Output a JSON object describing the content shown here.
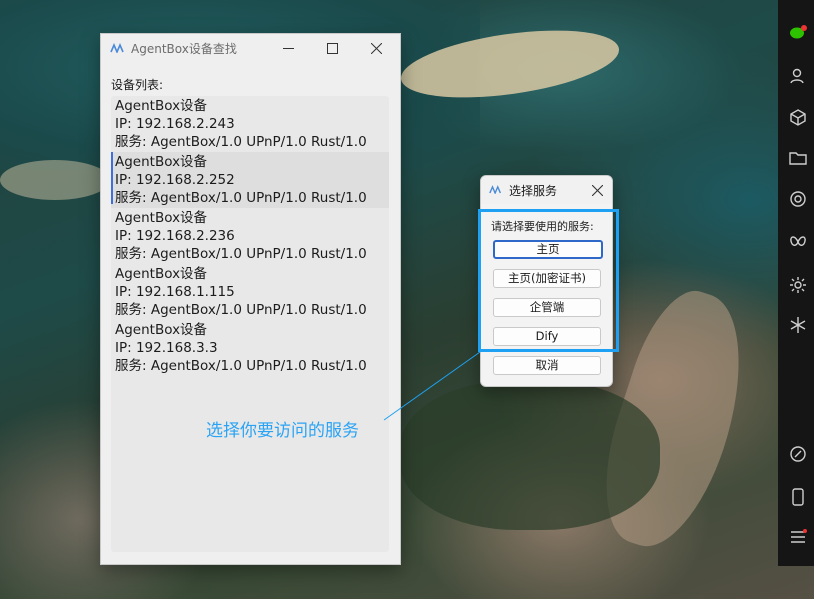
{
  "main_window": {
    "title": "AgentBox设备查找",
    "list_label": "设备列表:",
    "devices": [
      {
        "name": "AgentBox设备",
        "ip": "IP: 192.168.2.243",
        "service": "服务: AgentBox/1.0 UPnP/1.0 Rust/1.0"
      },
      {
        "name": "AgentBox设备",
        "ip": "IP: 192.168.2.252",
        "service": "服务: AgentBox/1.0 UPnP/1.0 Rust/1.0"
      },
      {
        "name": "AgentBox设备",
        "ip": "IP: 192.168.2.236",
        "service": "服务: AgentBox/1.0 UPnP/1.0 Rust/1.0"
      },
      {
        "name": "AgentBox设备",
        "ip": "IP: 192.168.1.115",
        "service": "服务: AgentBox/1.0 UPnP/1.0 Rust/1.0"
      },
      {
        "name": "AgentBox设备",
        "ip": "IP: 192.168.3.3",
        "service": "服务: AgentBox/1.0 UPnP/1.0 Rust/1.0"
      }
    ],
    "selected_index": 1,
    "controls": {
      "minimize": "minimize-icon",
      "maximize": "maximize-icon",
      "close": "close-icon"
    }
  },
  "dialog": {
    "title": "选择服务",
    "prompt": "请选择要使用的服务:",
    "buttons": {
      "home": "主页",
      "home_cert": "主页(加密证书)",
      "enterprise": "企管端",
      "dify": "Dify",
      "cancel": "取消"
    }
  },
  "annotation": {
    "text": "选择你要访问的服务",
    "color": "#1ea1f2"
  },
  "dock": {
    "icons": [
      "wechat-icon",
      "contacts-icon",
      "package-icon",
      "folder-icon",
      "aperture-icon",
      "butterfly-icon",
      "settings-icon",
      "spark-icon",
      "link-icon",
      "phone-icon",
      "menu-icon"
    ]
  },
  "colors": {
    "accent": "#2e68c9",
    "selection": "#3f6fd8"
  }
}
